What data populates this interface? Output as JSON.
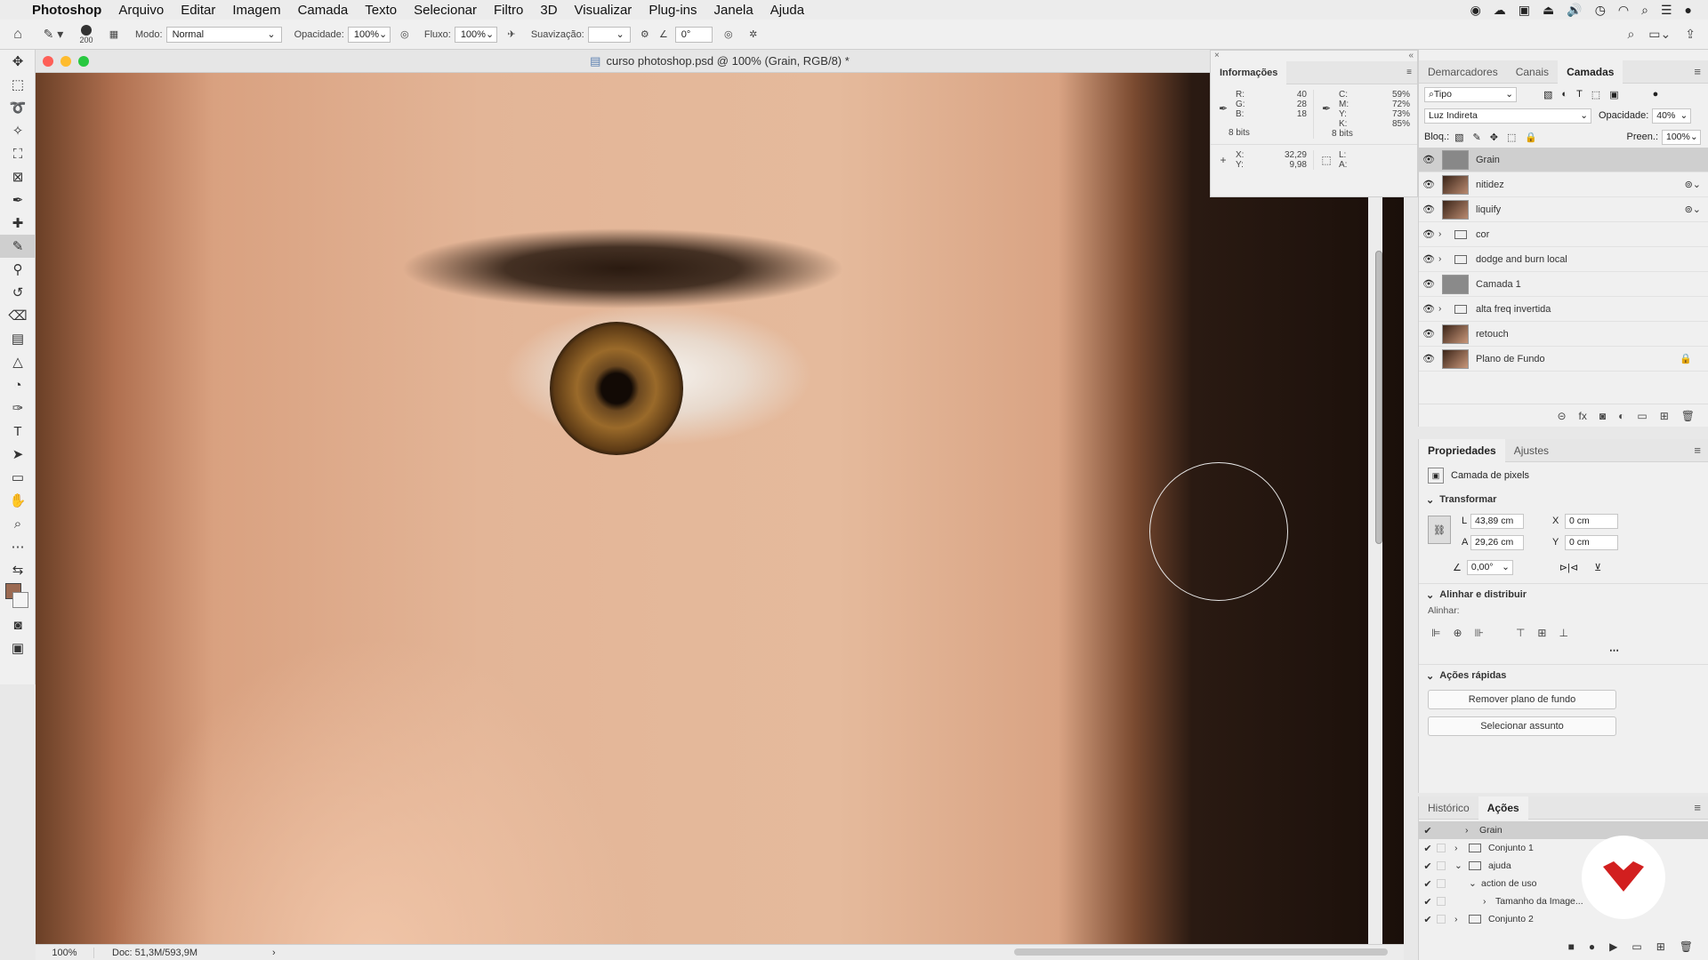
{
  "menubar": {
    "app": "Photoshop",
    "items": [
      "Arquivo",
      "Editar",
      "Imagem",
      "Camada",
      "Texto",
      "Selecionar",
      "Filtro",
      "3D",
      "Visualizar",
      "Plug-ins",
      "Janela",
      "Ajuda"
    ]
  },
  "options": {
    "brush_size": "200",
    "mode_label": "Modo:",
    "mode_value": "Normal",
    "opacity_label": "Opacidade:",
    "opacity_value": "100%",
    "flow_label": "Fluxo:",
    "flow_value": "100%",
    "smoothing_label": "Suavização:",
    "angle_value": "0°"
  },
  "document": {
    "title": "curso photoshop.psd @ 100% (Grain, RGB/8) *",
    "zoom": "100%",
    "doc_size": "Doc: 51,3M/593,9M"
  },
  "info": {
    "tab": "Informações",
    "r_label": "R:",
    "r": "40",
    "g_label": "G:",
    "g": "28",
    "b_label": "B:",
    "b": "18",
    "bits1": "8 bits",
    "c_label": "C:",
    "c": "59%",
    "m_label": "M:",
    "m": "72%",
    "y_label": "Y:",
    "y": "73%",
    "k_label": "K:",
    "k": "85%",
    "bits2": "8 bits",
    "x_label": "X:",
    "x": "32,29",
    "yy_label": "Y:",
    "yy": "9,98",
    "l_label": "L:",
    "a_label": "A:"
  },
  "layers_panel": {
    "tabs": [
      "Demarcadores",
      "Canais",
      "Camadas"
    ],
    "kind": "Tipo",
    "blend": "Luz Indireta",
    "opacity_label": "Opacidade:",
    "opacity": "40%",
    "lock_label": "Bloq.:",
    "fill_label": "Preen.:",
    "fill": "100%",
    "layers": [
      {
        "name": "Grain",
        "type": "gray"
      },
      {
        "name": "nitidez",
        "type": "photo"
      },
      {
        "name": "liquify",
        "type": "photo"
      },
      {
        "name": "cor",
        "type": "folder"
      },
      {
        "name": "dodge and burn local",
        "type": "folder"
      },
      {
        "name": "Camada 1",
        "type": "gray"
      },
      {
        "name": "alta freq invertida",
        "type": "folder"
      },
      {
        "name": "retouch",
        "type": "photo"
      },
      {
        "name": "Plano de Fundo",
        "type": "photo"
      }
    ]
  },
  "props": {
    "tabs": [
      "Propriedades",
      "Ajustes"
    ],
    "kind": "Camada de pixels",
    "transform": "Transformar",
    "w_label": "L",
    "w": "43,89 cm",
    "h_label": "A",
    "h": "29,26 cm",
    "x_label": "X",
    "x": "0 cm",
    "y_label": "Y",
    "y": "0 cm",
    "angle": "0,00°",
    "align_title": "Alinhar e distribuir",
    "align_label": "Alinhar:",
    "quick_title": "Ações rápidas",
    "btn_remove": "Remover plano de fundo",
    "btn_select": "Selecionar assunto"
  },
  "history": {
    "tabs": [
      "Histórico",
      "Ações"
    ],
    "actions": [
      {
        "name": "Grain",
        "indent": 0,
        "kind": "step"
      },
      {
        "name": "Conjunto 1",
        "indent": 0,
        "kind": "set"
      },
      {
        "name": "ajuda",
        "indent": 0,
        "kind": "set-open"
      },
      {
        "name": "action de uso",
        "indent": 1,
        "kind": "action"
      },
      {
        "name": "Tamanho da Image...",
        "indent": 2,
        "kind": "step"
      },
      {
        "name": "Conjunto 2",
        "indent": 0,
        "kind": "set"
      }
    ]
  }
}
